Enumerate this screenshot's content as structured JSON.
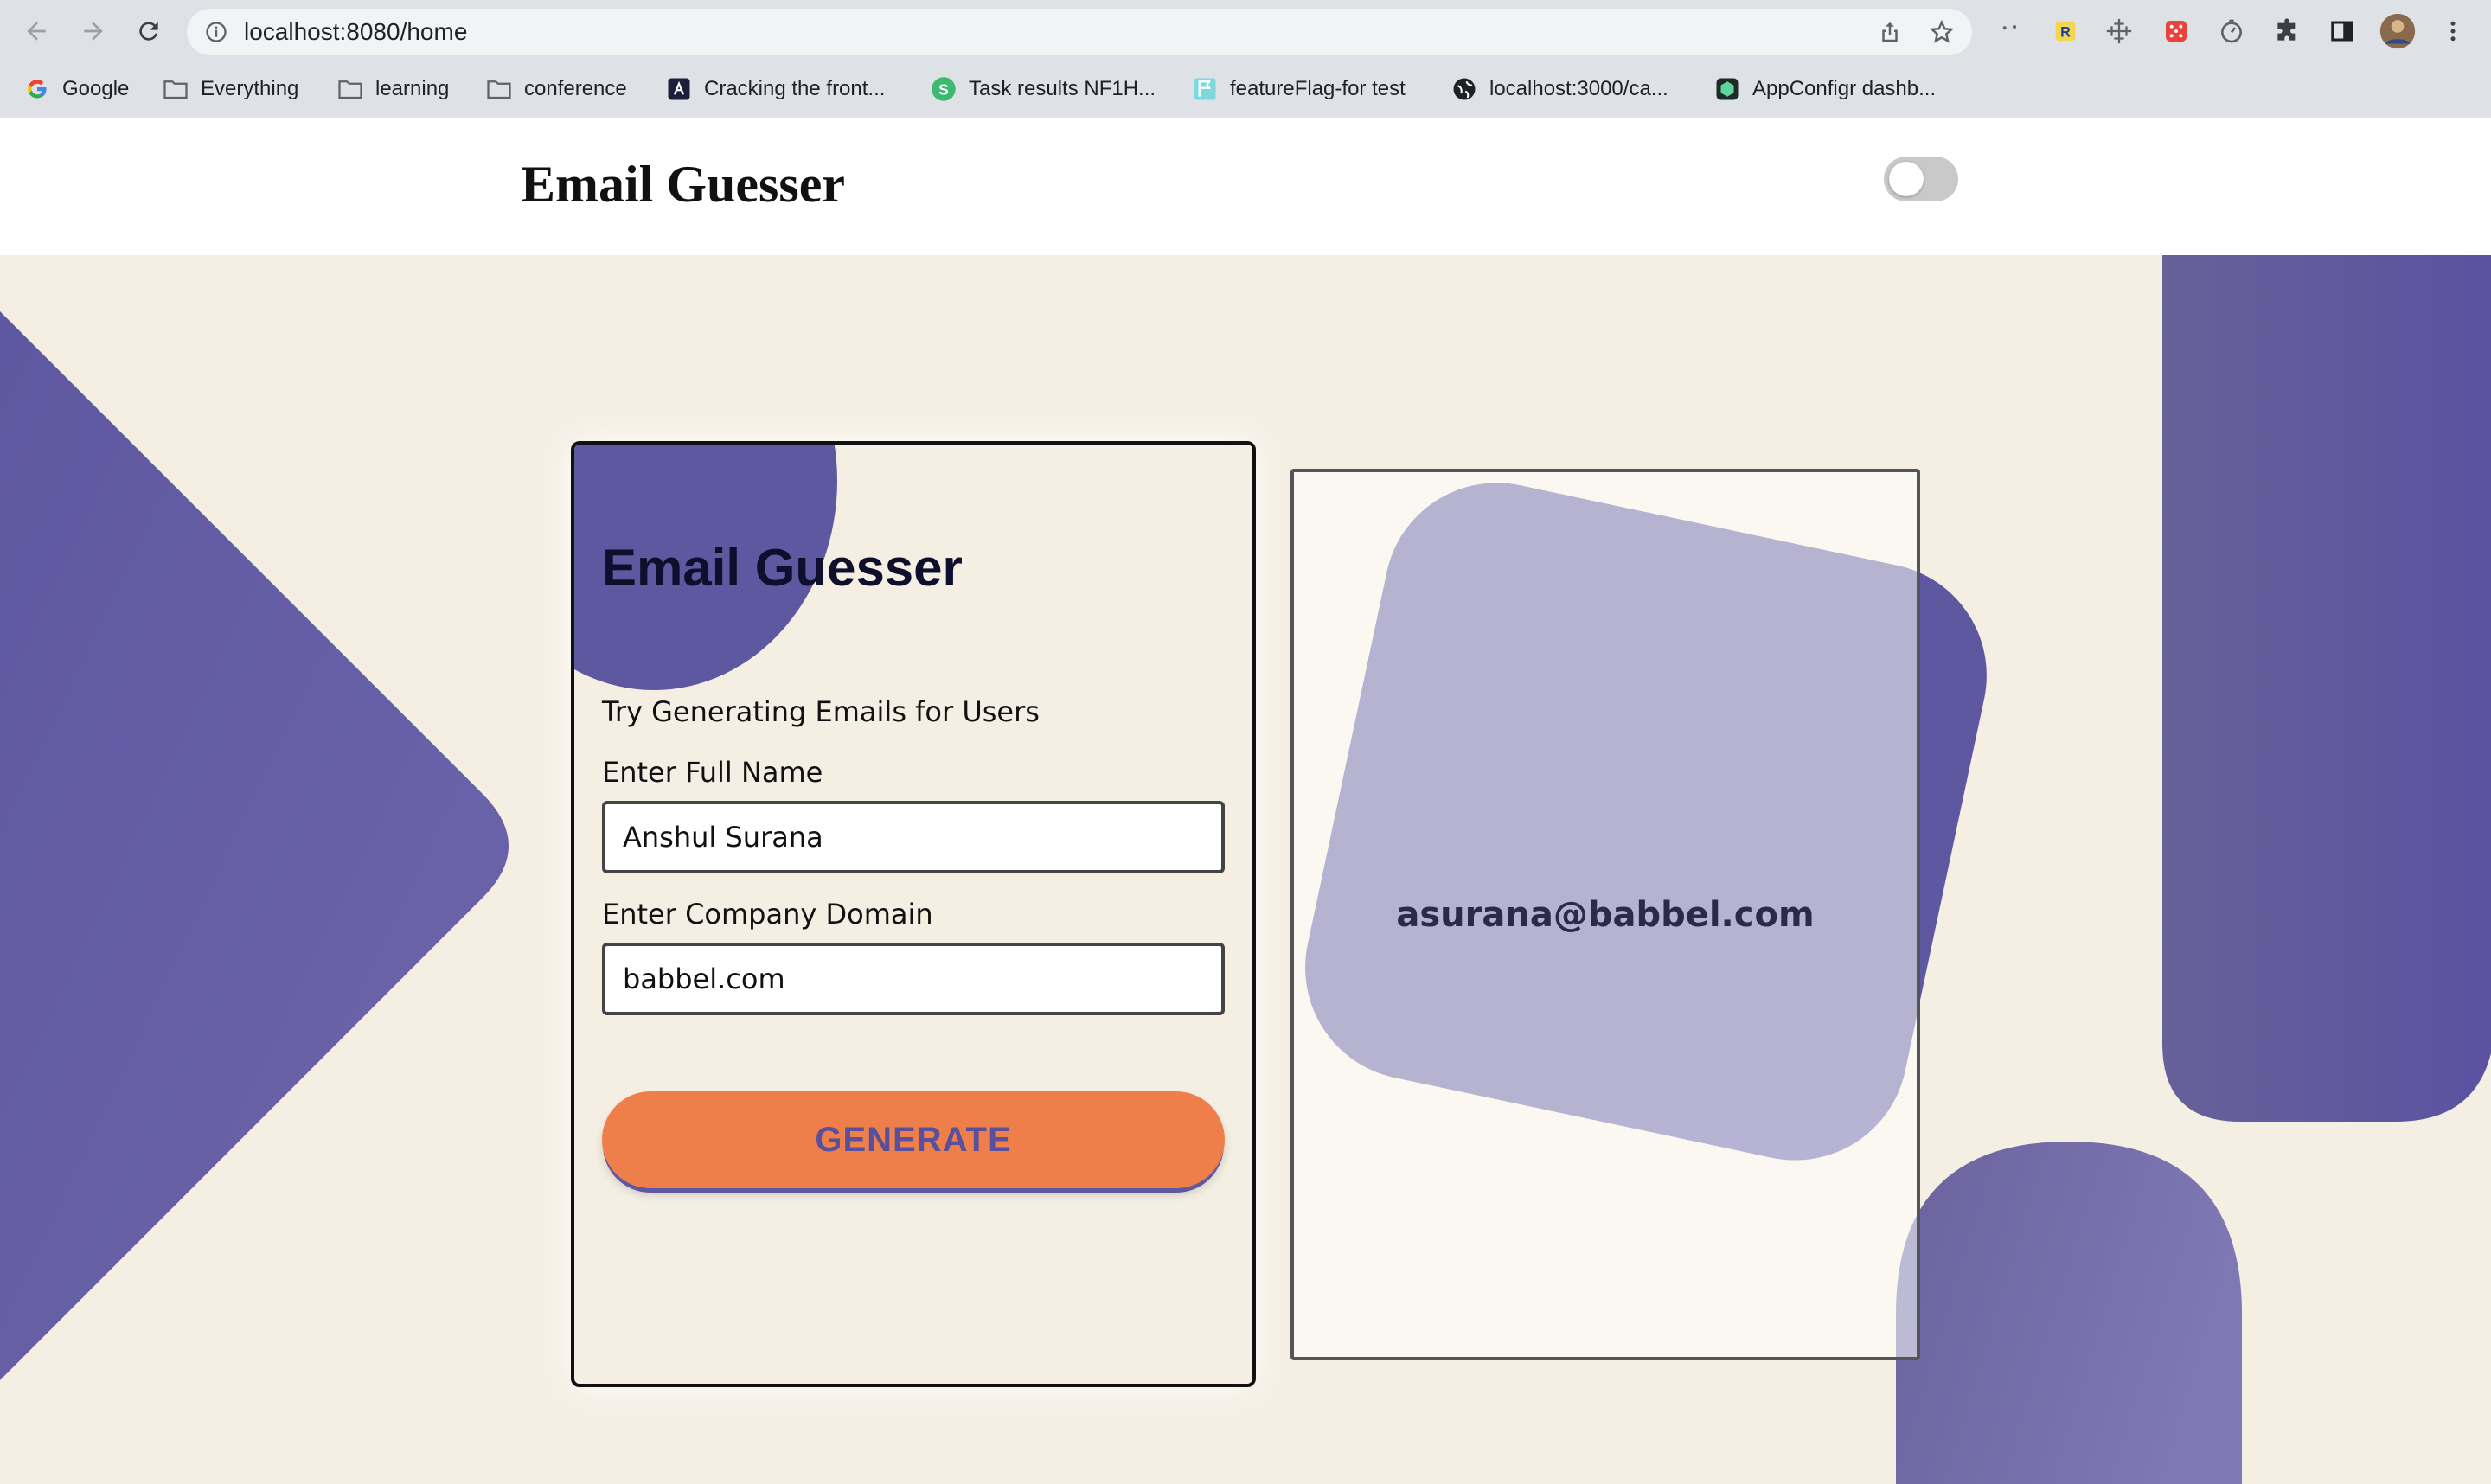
{
  "browser": {
    "url": "localhost:8080/home",
    "bookmarks": [
      {
        "label": "Google",
        "icon": "google-icon"
      },
      {
        "label": "Everything",
        "icon": "folder-icon"
      },
      {
        "label": "learning",
        "icon": "folder-icon"
      },
      {
        "label": "conference",
        "icon": "folder-icon"
      },
      {
        "label": "Cracking the front...",
        "icon": "site-icon"
      },
      {
        "label": "Task results NF1H...",
        "icon": "s-icon"
      },
      {
        "label": "featureFlag-for test",
        "icon": "flag-icon"
      },
      {
        "label": "localhost:3000/ca...",
        "icon": "globe-icon"
      },
      {
        "label": "AppConfigr dashb...",
        "icon": "cube-icon"
      }
    ]
  },
  "header": {
    "title": "Email Guesser",
    "theme_toggle_on": false
  },
  "form": {
    "heading": "Email Guesser",
    "subtitle": "Try Generating Emails for Users",
    "name_label": "Enter Full Name",
    "name_value": "Anshul Surana",
    "domain_label": "Enter Company Domain",
    "domain_value": "babbel.com",
    "button_label": "GENERATE"
  },
  "result": {
    "email": "asurana@babbel.com"
  },
  "colors": {
    "background": "#f5efe3",
    "accent_purple": "#5e58a0",
    "button_orange": "#ee7f4b"
  }
}
